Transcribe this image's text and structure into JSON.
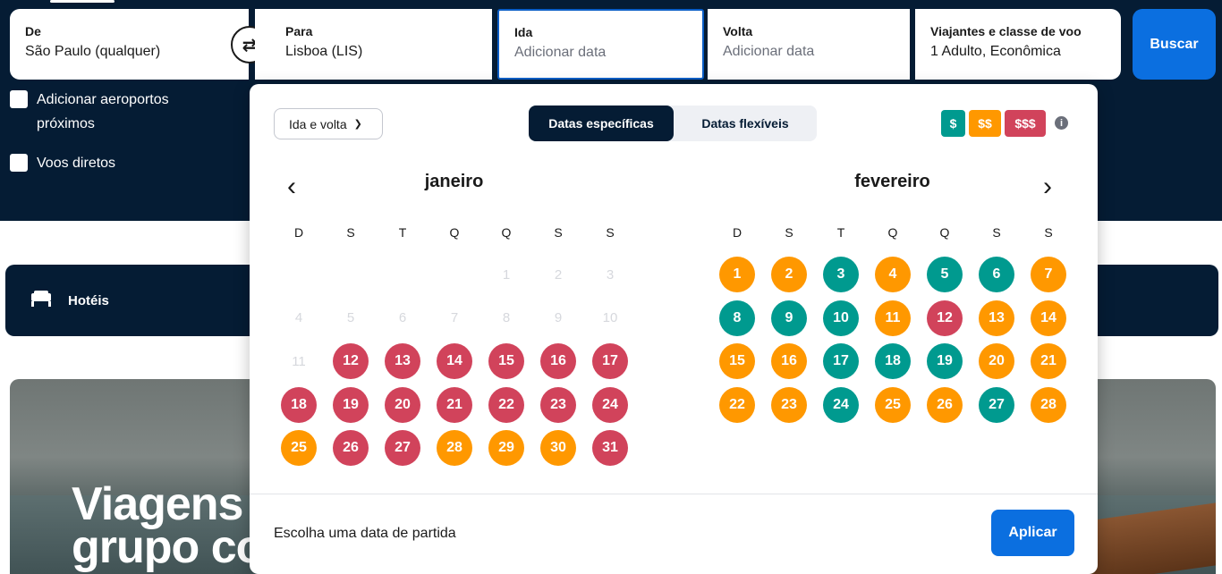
{
  "search": {
    "from": {
      "label": "De",
      "value": "São Paulo (qualquer)"
    },
    "to": {
      "label": "Para",
      "value": "Lisboa (LIS)"
    },
    "depart": {
      "label": "Ida",
      "placeholder": "Adicionar data"
    },
    "return": {
      "label": "Volta",
      "placeholder": "Adicionar data"
    },
    "travelers": {
      "label": "Viajantes e classe de voo",
      "value": "1 Adulto, Econômica"
    },
    "swap_icon": "⇄",
    "search_button": "Buscar",
    "nearby_airports": "Adicionar aeroportos próximos",
    "direct_flights": "Voos diretos"
  },
  "hotels": {
    "label": "Hotéis",
    "icon": "bed-icon"
  },
  "hero": {
    "line1": "Viagens e",
    "line2": "grupo co"
  },
  "datepicker": {
    "trip_type": "Ida e volta",
    "mode_specific": "Datas específicas",
    "mode_flexible": "Datas flexíveis",
    "price_legend": [
      {
        "label": "$",
        "color": "#009a8f"
      },
      {
        "label": "$$",
        "color": "#ff9800"
      },
      {
        "label": "$$$",
        "color": "#d1435b"
      }
    ],
    "info_icon": "i",
    "prev_icon": "‹",
    "next_icon": "›",
    "weekdays": [
      "D",
      "S",
      "T",
      "Q",
      "Q",
      "S",
      "S"
    ],
    "price_colors": {
      "r": "#d1435b",
      "o": "#ff9800",
      "t": "#009a8f"
    },
    "months": [
      {
        "name": "janeiro",
        "offset": 4,
        "days": [
          {
            "n": 1,
            "s": "x"
          },
          {
            "n": 2,
            "s": "x"
          },
          {
            "n": 3,
            "s": "x"
          },
          {
            "n": 4,
            "s": "x"
          },
          {
            "n": 5,
            "s": "x"
          },
          {
            "n": 6,
            "s": "x"
          },
          {
            "n": 7,
            "s": "x"
          },
          {
            "n": 8,
            "s": "x"
          },
          {
            "n": 9,
            "s": "x"
          },
          {
            "n": 10,
            "s": "x"
          },
          {
            "n": 11,
            "s": "x"
          },
          {
            "n": 12,
            "s": "r"
          },
          {
            "n": 13,
            "s": "r"
          },
          {
            "n": 14,
            "s": "r"
          },
          {
            "n": 15,
            "s": "r"
          },
          {
            "n": 16,
            "s": "r"
          },
          {
            "n": 17,
            "s": "r"
          },
          {
            "n": 18,
            "s": "r"
          },
          {
            "n": 19,
            "s": "r"
          },
          {
            "n": 20,
            "s": "r"
          },
          {
            "n": 21,
            "s": "r"
          },
          {
            "n": 22,
            "s": "r"
          },
          {
            "n": 23,
            "s": "r"
          },
          {
            "n": 24,
            "s": "r"
          },
          {
            "n": 25,
            "s": "o"
          },
          {
            "n": 26,
            "s": "r"
          },
          {
            "n": 27,
            "s": "r"
          },
          {
            "n": 28,
            "s": "o"
          },
          {
            "n": 29,
            "s": "o"
          },
          {
            "n": 30,
            "s": "o"
          },
          {
            "n": 31,
            "s": "r"
          }
        ]
      },
      {
        "name": "fevereiro",
        "offset": 0,
        "days": [
          {
            "n": 1,
            "s": "o"
          },
          {
            "n": 2,
            "s": "o"
          },
          {
            "n": 3,
            "s": "t"
          },
          {
            "n": 4,
            "s": "o"
          },
          {
            "n": 5,
            "s": "t"
          },
          {
            "n": 6,
            "s": "t"
          },
          {
            "n": 7,
            "s": "o"
          },
          {
            "n": 8,
            "s": "t"
          },
          {
            "n": 9,
            "s": "t"
          },
          {
            "n": 10,
            "s": "t"
          },
          {
            "n": 11,
            "s": "o"
          },
          {
            "n": 12,
            "s": "r"
          },
          {
            "n": 13,
            "s": "o"
          },
          {
            "n": 14,
            "s": "o"
          },
          {
            "n": 15,
            "s": "o"
          },
          {
            "n": 16,
            "s": "o"
          },
          {
            "n": 17,
            "s": "t"
          },
          {
            "n": 18,
            "s": "t"
          },
          {
            "n": 19,
            "s": "t"
          },
          {
            "n": 20,
            "s": "o"
          },
          {
            "n": 21,
            "s": "o"
          },
          {
            "n": 22,
            "s": "o"
          },
          {
            "n": 23,
            "s": "o"
          },
          {
            "n": 24,
            "s": "t"
          },
          {
            "n": 25,
            "s": "o"
          },
          {
            "n": 26,
            "s": "o"
          },
          {
            "n": 27,
            "s": "t"
          },
          {
            "n": 28,
            "s": "o"
          }
        ]
      }
    ],
    "footer_text": "Escolha uma data de partida",
    "apply_button": "Aplicar"
  }
}
